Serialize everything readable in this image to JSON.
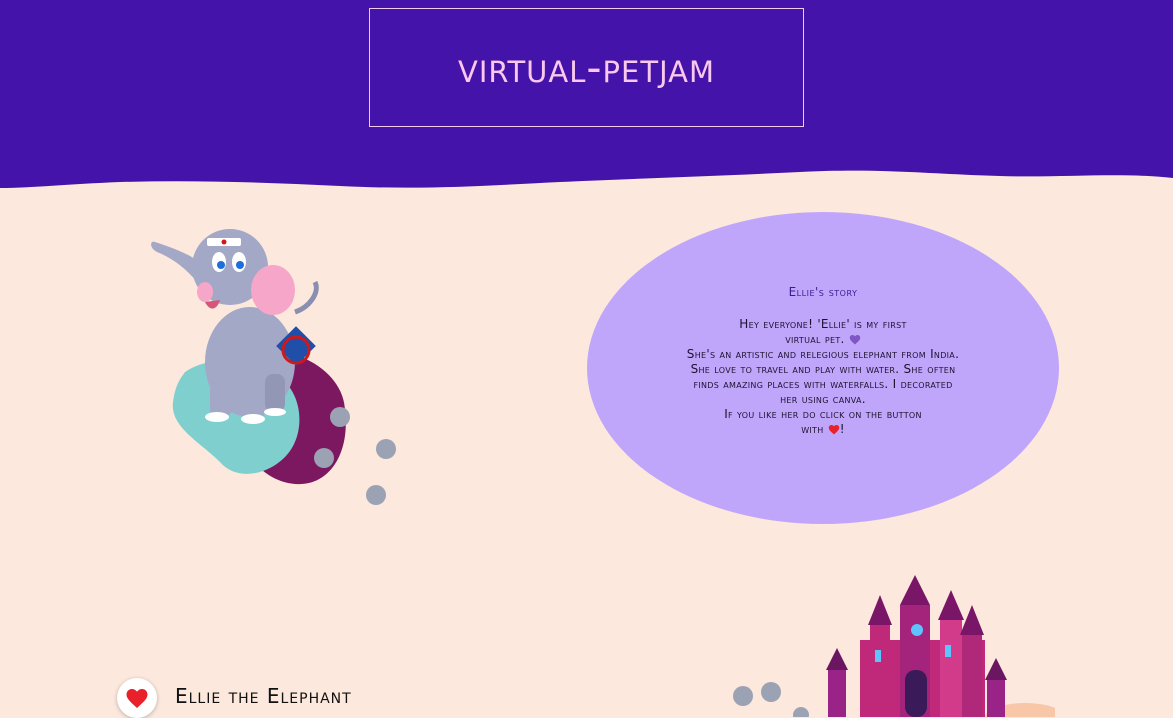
{
  "header": {
    "title": "Virtual-PetJam"
  },
  "story": {
    "title": "Ellie's story",
    "line1": "Hey everyone! 'Ellie' is my first",
    "line2": "virtual pet.",
    "line3": "She's an artistic and relegious elephant from India. She love to travel and play with water. She often finds amazing places with waterfalls. I decorated her using canva.",
    "line4": "If you like her do click on the button",
    "line5a": "with",
    "line5b": "!"
  },
  "pet": {
    "name": "Ellie the Elephant"
  },
  "icons": {
    "like": "heart-icon",
    "story_heart": "purple-heart-icon",
    "story_heart_red": "red-heart-icon",
    "paw": "paw-print-icon"
  },
  "colors": {
    "header_bg": "#4413aa",
    "page_bg": "#fce8dc",
    "bubble_bg": "#c0a6fb",
    "title_text": "#f9c8ec",
    "heart_red": "#e8212b"
  }
}
